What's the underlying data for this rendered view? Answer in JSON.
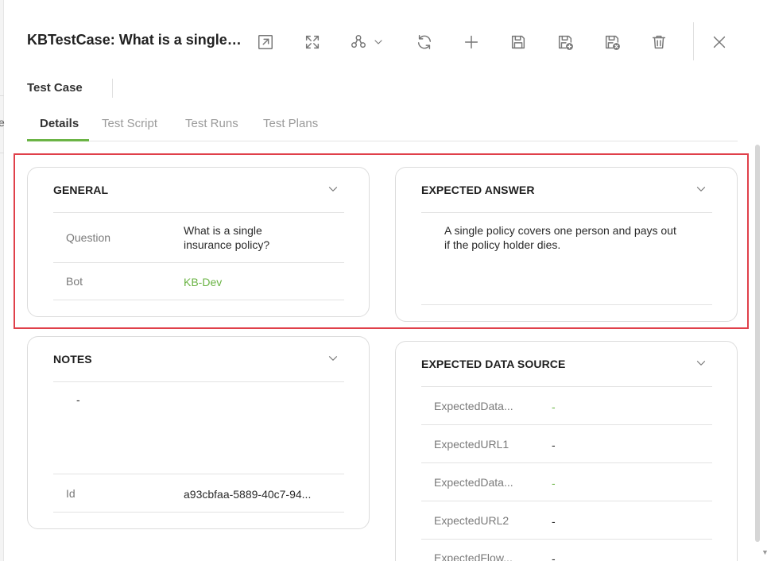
{
  "header": {
    "title": "KBTestCase: What is a single insurance policy?",
    "toolbar": [
      {
        "icon": "open-external-icon"
      },
      {
        "icon": "expand-icon"
      },
      {
        "icon": "workflow-icon"
      },
      {
        "icon": "refresh-icon"
      },
      {
        "icon": "add-icon"
      },
      {
        "icon": "save-icon"
      },
      {
        "icon": "save-and-new-icon"
      },
      {
        "icon": "save-and-close-icon"
      },
      {
        "icon": "delete-icon"
      },
      {
        "icon": "close-icon"
      }
    ]
  },
  "record_type": "Test Case",
  "tabs": [
    "Details",
    "Test Script",
    "Test Runs",
    "Test Plans"
  ],
  "active_tab": "Details",
  "general": {
    "title": "GENERAL",
    "question_label": "Question",
    "question_value": "What is a single insurance policy?",
    "bot_label": "Bot",
    "bot_value": "KB-Dev"
  },
  "expected_answer": {
    "title": "EXPECTED ANSWER",
    "text": "A single policy covers one person and pays out if the policy holder dies."
  },
  "notes": {
    "title": "NOTES",
    "text": "-",
    "id_label": "Id",
    "id_value": "a93cbfaa-5889-40c7-94..."
  },
  "expected_data_source": {
    "title": "EXPECTED DATA SOURCE",
    "rows": [
      {
        "label": "ExpectedData...",
        "value": "-"
      },
      {
        "label": "ExpectedURL1",
        "value": "-"
      },
      {
        "label": "ExpectedData...",
        "value": "-"
      },
      {
        "label": "ExpectedURL2",
        "value": "-"
      },
      {
        "label": "ExpectedFlow...",
        "value": "-"
      }
    ]
  },
  "colors": {
    "accent": "#6bb445",
    "highlight": "#e0404a"
  }
}
